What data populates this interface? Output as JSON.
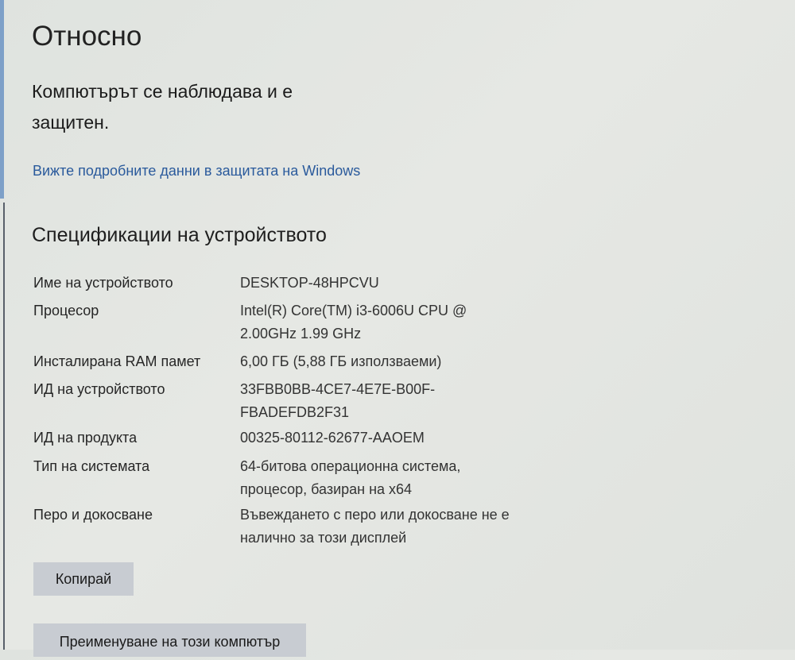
{
  "page": {
    "title": "Относно",
    "protection_status": "Компютърът се наблюдава и е защитен.",
    "defender_link": "Вижте подробните данни в защитата на Windows"
  },
  "specs": {
    "heading": "Спецификации на устройството",
    "rows": [
      {
        "label": "Име на устройството",
        "value": "DESKTOP-48HPCVU"
      },
      {
        "label": "Процесор",
        "value": "Intel(R) Core(TM) i3-6006U CPU @ 2.00GHz   1.99 GHz"
      },
      {
        "label": "Инсталирана RAM памет",
        "value": "6,00 ГБ (5,88 ГБ използваеми)"
      },
      {
        "label": "ИД на устройството",
        "value": "33FBB0BB-4CE7-4E7E-B00F-FBADEFDB2F31"
      },
      {
        "label": "ИД на продукта",
        "value": "00325-80112-62677-AAOEM"
      },
      {
        "label": "Тип на системата",
        "value": "64-битова операционна система, процесор, базиран на x64"
      },
      {
        "label": "Перо и докосване",
        "value": "Въвеждането с перо или докосване не е налично за този дисплей"
      }
    ]
  },
  "buttons": {
    "copy": "Копирай",
    "rename": "Преименуване на този компютър"
  },
  "colors": {
    "link": "#2a5a9c",
    "button_bg": "#c8ccd2",
    "accent": "#7ea0c8"
  }
}
